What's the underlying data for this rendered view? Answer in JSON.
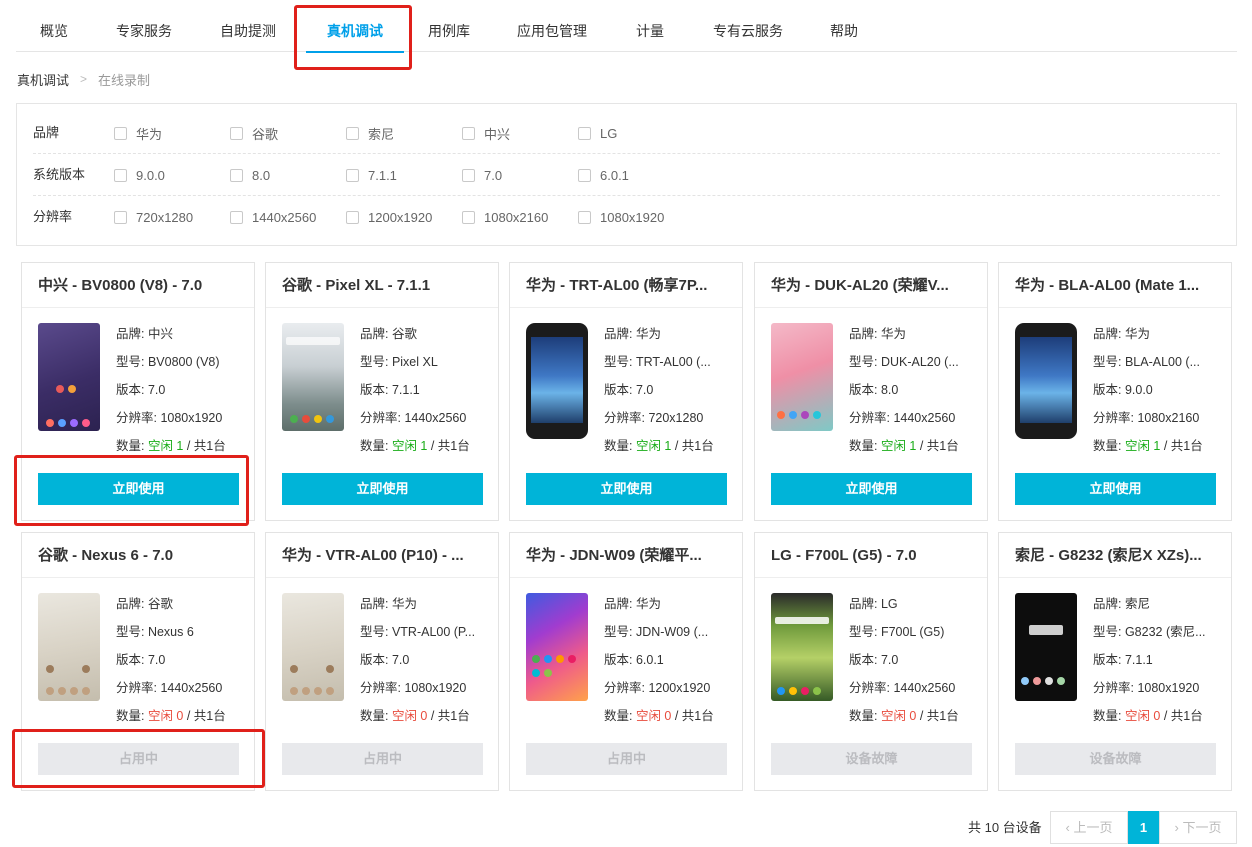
{
  "nav": {
    "tabs": [
      {
        "label": "概览"
      },
      {
        "label": "专家服务"
      },
      {
        "label": "自助提测"
      },
      {
        "label": "真机调试"
      },
      {
        "label": "用例库"
      },
      {
        "label": "应用包管理"
      },
      {
        "label": "计量"
      },
      {
        "label": "专有云服务"
      },
      {
        "label": "帮助"
      }
    ],
    "active_index": 3
  },
  "breadcrumb": {
    "parent": "真机调试",
    "separator": ">",
    "current": "在线录制"
  },
  "filters": {
    "rows": [
      {
        "label": "品牌",
        "options": [
          "华为",
          "谷歌",
          "索尼",
          "中兴",
          "LG"
        ]
      },
      {
        "label": "系统版本",
        "options": [
          "9.0.0",
          "8.0",
          "7.1.1",
          "7.0",
          "6.0.1"
        ]
      },
      {
        "label": "分辨率",
        "options": [
          "720x1280",
          "1440x2560",
          "1200x1920",
          "1080x2160",
          "1080x1920"
        ]
      }
    ]
  },
  "devices": [
    {
      "title": "中兴 - BV0800 (V8) - 7.0",
      "brand": "品牌: 中兴",
      "model": "型号: BV0800 (V8)",
      "version": "版本: 7.0",
      "resolution": "分辨率: 1080x1920",
      "qty_prefix": "数量: ",
      "free": "空闲 1",
      "qty_suffix": " / 共1台",
      "button": "立即使用",
      "status": "available",
      "screen": "purple"
    },
    {
      "title": "谷歌 - Pixel XL - 7.1.1",
      "brand": "品牌: 谷歌",
      "model": "型号: Pixel XL",
      "version": "版本: 7.1.1",
      "resolution": "分辨率: 1440x2560",
      "qty_prefix": "数量: ",
      "free": "空闲 1",
      "qty_suffix": " / 共1台",
      "button": "立即使用",
      "status": "available",
      "screen": "pixel"
    },
    {
      "title": "华为 - TRT-AL00 (畅享7P...",
      "brand": "品牌: 华为",
      "model": "型号: TRT-AL00 (...",
      "version": "版本: 7.0",
      "resolution": "分辨率: 720x1280",
      "qty_prefix": "数量: ",
      "free": "空闲 1",
      "qty_suffix": " / 共1台",
      "button": "立即使用",
      "status": "available",
      "screen": "handset"
    },
    {
      "title": "华为 - DUK-AL20 (荣耀V...",
      "brand": "品牌: 华为",
      "model": "型号: DUK-AL20 (...",
      "version": "版本: 8.0",
      "resolution": "分辨率: 1440x2560",
      "qty_prefix": "数量: ",
      "free": "空闲 1",
      "qty_suffix": " / 共1台",
      "button": "立即使用",
      "status": "available",
      "screen": "pink"
    },
    {
      "title": "华为 - BLA-AL00 (Mate 1...",
      "brand": "品牌: 华为",
      "model": "型号: BLA-AL00 (...",
      "version": "版本: 9.0.0",
      "resolution": "分辨率: 1080x2160",
      "qty_prefix": "数量: ",
      "free": "空闲 1",
      "qty_suffix": " / 共1台",
      "button": "立即使用",
      "status": "available",
      "screen": "handset"
    },
    {
      "title": "谷歌 - Nexus 6 - 7.0",
      "brand": "品牌: 谷歌",
      "model": "型号: Nexus 6",
      "version": "版本: 7.0",
      "resolution": "分辨率: 1440x2560",
      "qty_prefix": "数量: ",
      "free": "空闲 0",
      "qty_suffix": " / 共1台",
      "button": "占用中",
      "status": "busy",
      "screen": "beige"
    },
    {
      "title": "华为 - VTR-AL00 (P10) - ...",
      "brand": "品牌: 华为",
      "model": "型号: VTR-AL00 (P...",
      "version": "版本: 7.0",
      "resolution": "分辨率: 1080x1920",
      "qty_prefix": "数量: ",
      "free": "空闲 0",
      "qty_suffix": " / 共1台",
      "button": "占用中",
      "status": "busy",
      "screen": "beige"
    },
    {
      "title": "华为 - JDN-W09 (荣耀平...",
      "brand": "品牌: 华为",
      "model": "型号: JDN-W09 (...",
      "version": "版本: 6.0.1",
      "resolution": "分辨率: 1200x1920",
      "qty_prefix": "数量: ",
      "free": "空闲 0",
      "qty_suffix": " / 共1台",
      "button": "占用中",
      "status": "busy",
      "screen": "colorful"
    },
    {
      "title": "LG - F700L (G5) - 7.0",
      "brand": "品牌: LG",
      "model": "型号: F700L (G5)",
      "version": "版本: 7.0",
      "resolution": "分辨率: 1440x2560",
      "qty_prefix": "数量: ",
      "free": "空闲 0",
      "qty_suffix": " / 共1台",
      "button": "设备故障",
      "status": "fault",
      "screen": "green"
    },
    {
      "title": "索尼 - G8232 (索尼X XZs)...",
      "brand": "品牌: 索尼",
      "model": "型号: G8232 (索尼...",
      "version": "版本: 7.1.1",
      "resolution": "分辨率: 1080x1920",
      "qty_prefix": "数量: ",
      "free": "空闲 0",
      "qty_suffix": " / 共1台",
      "button": "设备故障",
      "status": "fault",
      "screen": "black"
    }
  ],
  "pagination": {
    "total": "共 10 台设备",
    "prev": "上一页",
    "current": "1",
    "next": "下一页"
  },
  "colors": {
    "accent": "#00b4d8",
    "tab_active": "#00a0e9",
    "free_green": "#1aad19",
    "free_red": "#e84c3d",
    "highlight_red": "#e0201a",
    "disabled_bg": "#e8e9ec"
  }
}
